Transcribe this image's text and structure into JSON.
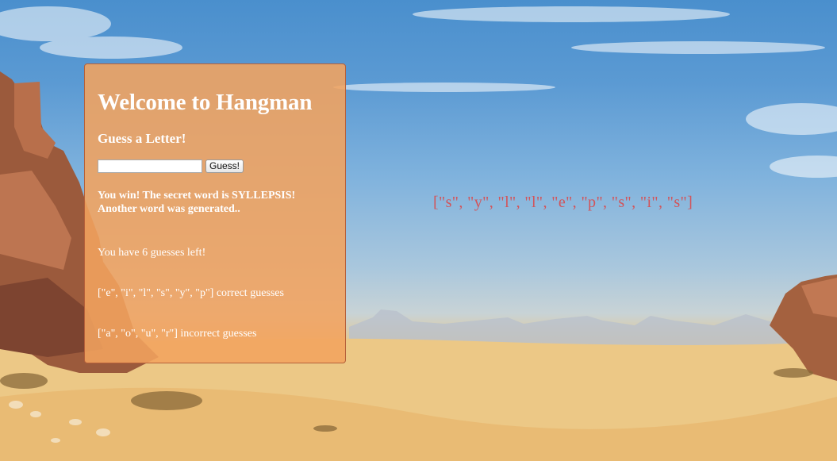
{
  "game": {
    "title": "Welcome to Hangman",
    "prompt": "Guess a Letter!",
    "input_placeholder": "",
    "guess_button": "Guess!",
    "win_line1": "You win! The secret word is SYLLEPSIS!",
    "win_line2": "Another word was generated..",
    "guesses_left": "You have 6 guesses left!",
    "correct_guesses": "[\"e\", \"i\", \"l\", \"s\", \"y\", \"p\"] correct guesses",
    "incorrect_guesses": "[\"a\", \"o\", \"u\", \"r\"] incorrect guesses"
  },
  "word_display": "[\"s\", \"y\", \"l\", \"l\", \"e\", \"p\", \"s\", \"i\", \"s\"]",
  "colors": {
    "panel_bg": "#f3a35e",
    "panel_border": "#b5603a",
    "panel_text": "#ffffff",
    "word_text": "#d2545a"
  }
}
